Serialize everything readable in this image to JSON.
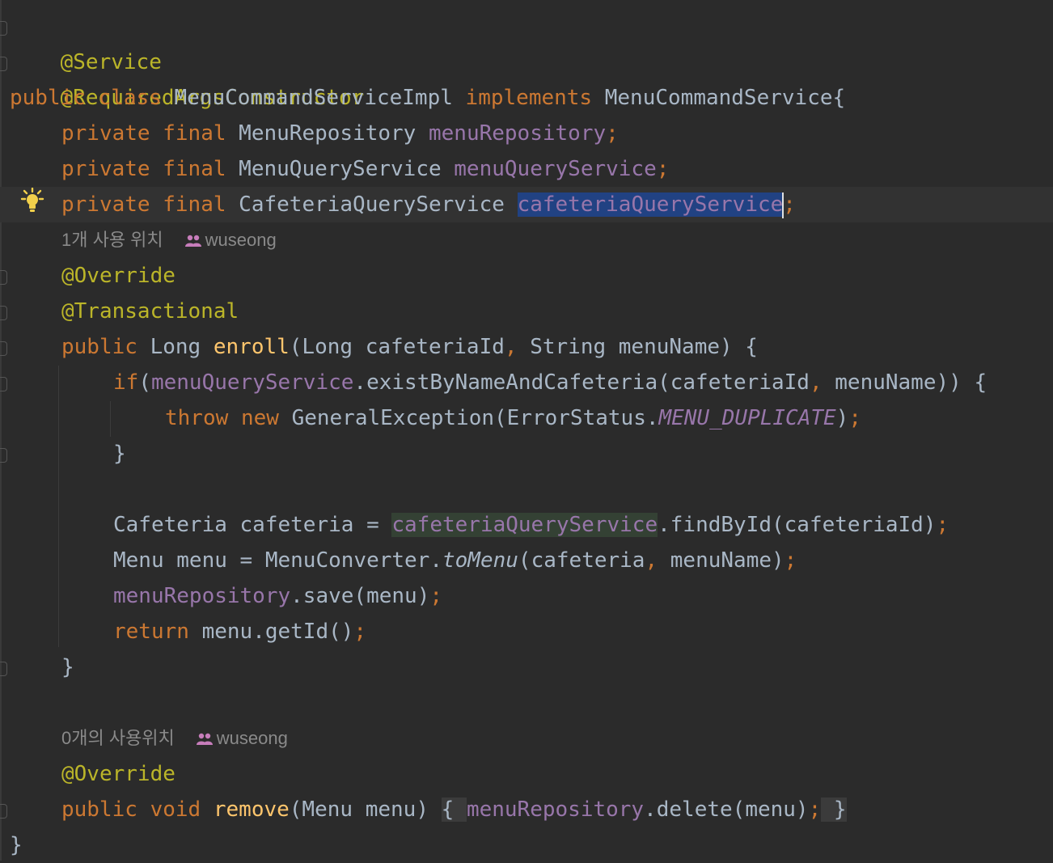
{
  "code": {
    "l1_ann": "@Service",
    "l2_ann": "@RequiredArgsConstructor",
    "l3_kw1": "public",
    "l3_kw2": "class",
    "l3_name": "MenuCommandServiceImpl",
    "l3_kw3": "implements",
    "l3_iface": "MenuCommandService{",
    "l4_kw1": "private",
    "l4_kw2": "final",
    "l4_type": "MenuRepository",
    "l4_field": "menuRepository",
    "l5_type": "MenuQueryService",
    "l5_field": "menuQueryService",
    "l6_type": "CafeteriaQueryService",
    "l6_field": "cafeteriaQueryService",
    "semi": ";",
    "comma": ",",
    "override": "@Override",
    "transactional": "@Transactional",
    "l10_type": "Long",
    "l10_fn": "enroll",
    "l10_params_a": "(Long cafeteriaId",
    "l10_params_b": " String menuName) {",
    "l11_if": "if",
    "l11_paren": "(",
    "l11_field": "menuQueryService",
    "l11_call_a": ".existByNameAndCafeteria(cafeteriaId",
    "l11_call_b": " menuName)) {",
    "l12_throw": "throw",
    "l12_new": "new",
    "l12_call": "GeneralException(ErrorStatus.",
    "l12_const": "MENU_DUPLICATE",
    "l12_end": ")",
    "brace_close": "}",
    "l15_decl": "Cafeteria cafeteria = ",
    "l15_field": "cafeteriaQueryService",
    "l15_call": ".findById(cafeteriaId)",
    "l16_decl": "Menu menu = MenuConverter.",
    "l16_fn": "toMenu",
    "l16_args_a": "(cafeteria",
    "l16_args_b": " menuName)",
    "l17_field": "menuRepository",
    "l17_call": ".save(menu)",
    "l18_return": "return",
    "l18_call": " menu.getId()",
    "l22_void": "void",
    "l22_fn": "remove",
    "l22_params": "(Menu menu) ",
    "l22_open": "{ ",
    "l22_field": "menuRepository",
    "l22_call": ".delete(menu)",
    "l22_close": " }"
  },
  "hints": {
    "usage1": "1개 사용 위치",
    "author1": "wuseong",
    "usage2": "0개의 사용위치",
    "author2": "wuseong"
  },
  "colors": {
    "background": "#2b2b2b",
    "keyword": "#cc7832",
    "annotation": "#bbb529",
    "field": "#9876aa",
    "function": "#ffc66d",
    "text": "#a9b7c6",
    "selection": "#214283"
  }
}
